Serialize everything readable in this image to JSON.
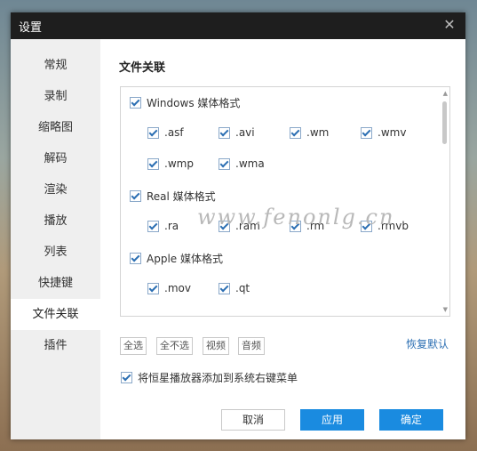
{
  "window": {
    "title": "设置"
  },
  "sidebar": {
    "items": [
      {
        "label": "常规"
      },
      {
        "label": "录制"
      },
      {
        "label": "缩略图"
      },
      {
        "label": "解码"
      },
      {
        "label": "渲染"
      },
      {
        "label": "播放"
      },
      {
        "label": "列表"
      },
      {
        "label": "快捷键"
      },
      {
        "label": "文件关联",
        "active": true
      },
      {
        "label": "插件"
      }
    ]
  },
  "file_assoc": {
    "title": "文件关联",
    "groups": [
      {
        "label": "Windows 媒体格式",
        "checked": true,
        "formats": [
          ".asf",
          ".avi",
          ".wm",
          ".wmv",
          ".wmp",
          ".wma"
        ]
      },
      {
        "label": "Real 媒体格式",
        "checked": true,
        "formats": [
          ".ra",
          ".ram",
          ".rm",
          ".rmvb"
        ]
      },
      {
        "label": "Apple 媒体格式",
        "checked": true,
        "formats": [
          ".mov",
          ".qt"
        ]
      }
    ],
    "buttons": {
      "select_all": "全选",
      "select_none": "全不选",
      "video": "视频",
      "audio": "音频"
    },
    "restore_default": "恢复默认",
    "context_menu_option": {
      "label": "将恒星播放器添加到系统右键菜单",
      "checked": true
    }
  },
  "footer": {
    "cancel": "取消",
    "apply": "应用",
    "ok": "确定"
  },
  "watermark": "www.fenonlg.cn",
  "colors": {
    "accent": "#1a8be0",
    "titlebar": "#1e1e1e",
    "sidebar": "#efefef",
    "link": "#2c6fb3"
  }
}
